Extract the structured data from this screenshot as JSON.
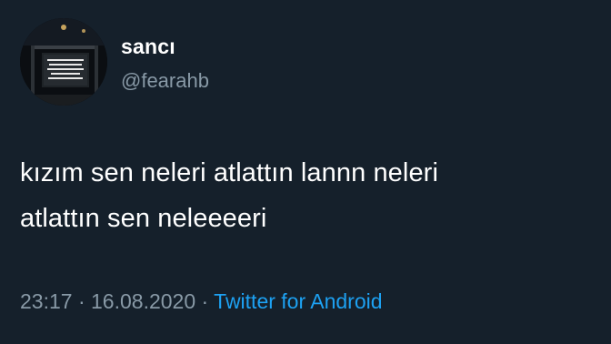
{
  "user": {
    "display_name": "sancı",
    "handle": "@fearahb"
  },
  "tweet": {
    "lines": [
      "kızım sen neleri atlattın lannn neleri",
      "atlattın sen neleeeeri"
    ]
  },
  "meta": {
    "time": "23:17",
    "separator1": " · ",
    "date": "16.08.2020",
    "separator2": " · ",
    "source": "Twitter for Android"
  },
  "colors": {
    "background": "#15202b",
    "primary_text": "#ffffff",
    "secondary_text": "#8899a6",
    "link": "#1da1f2"
  }
}
